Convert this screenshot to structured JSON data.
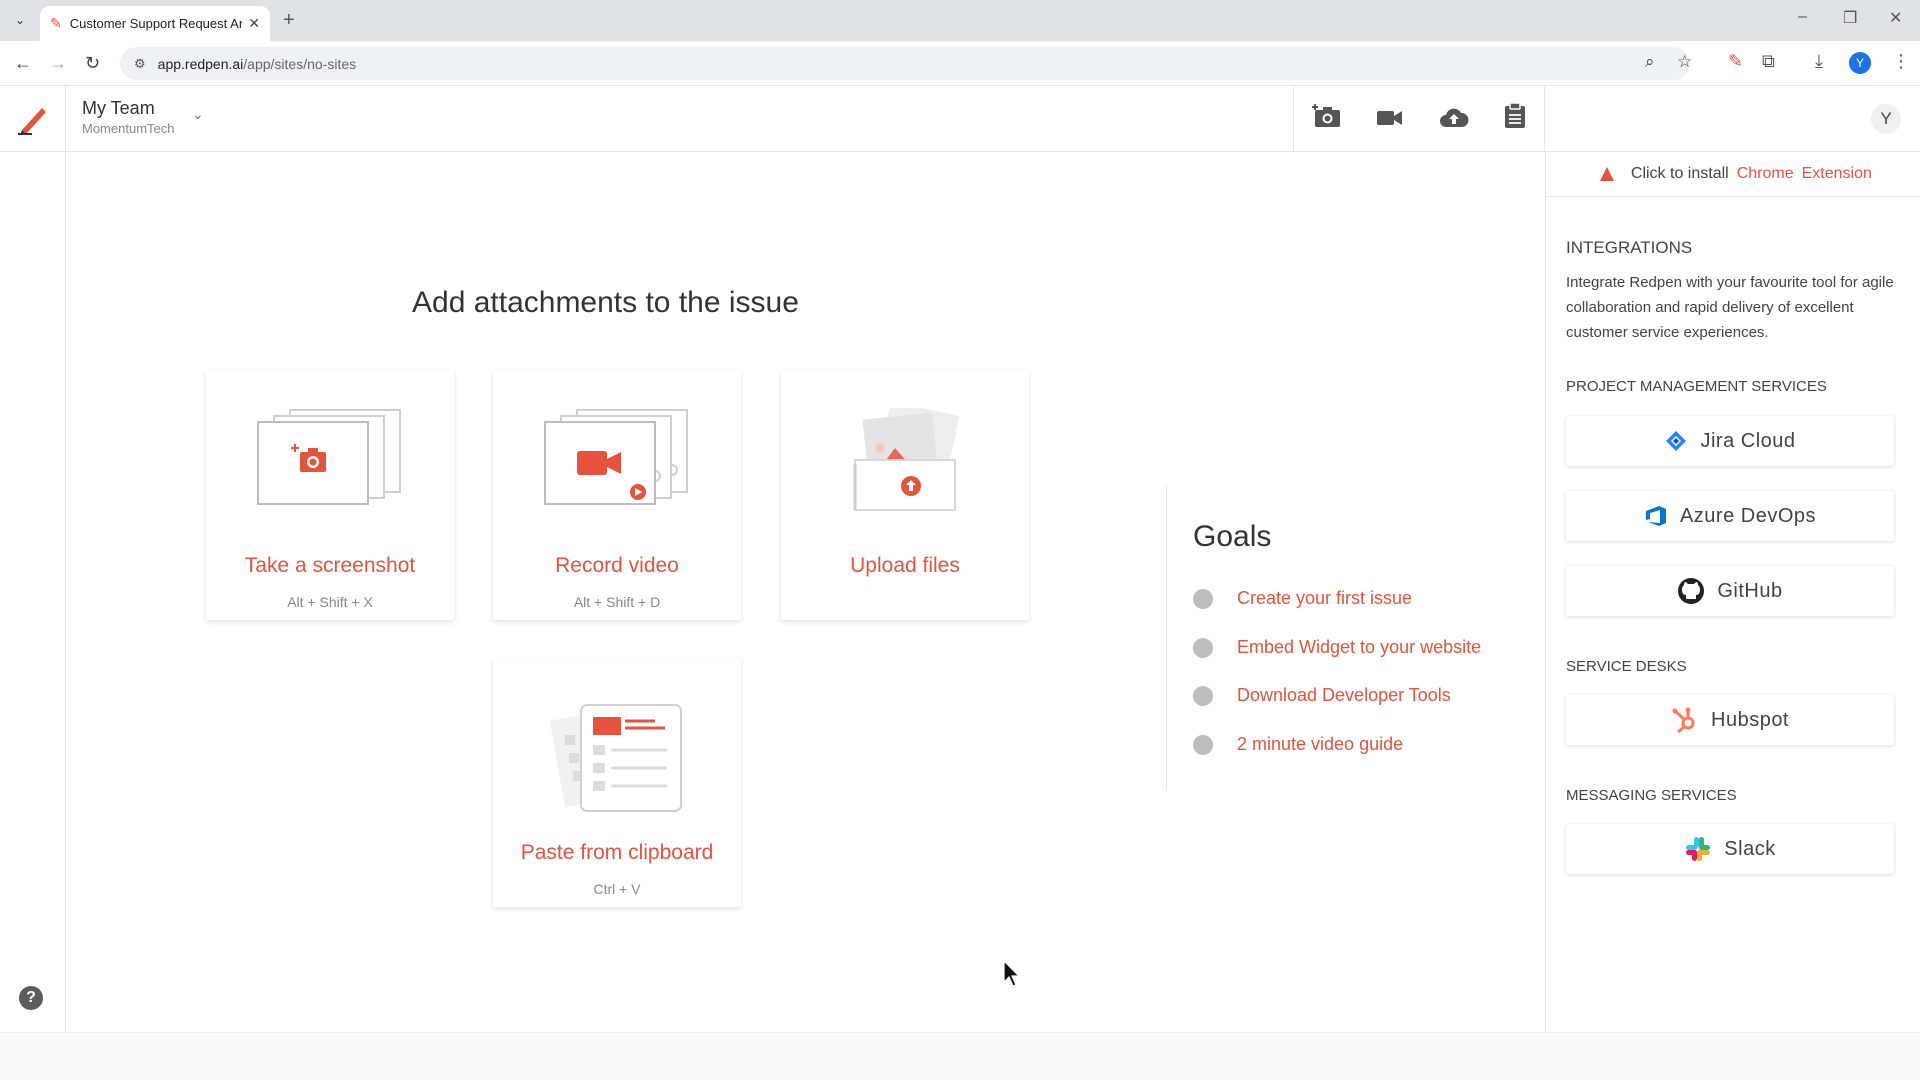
{
  "browser": {
    "tab_title": "Customer Support Request And",
    "url_host": "app.redpen.ai",
    "url_path": "/app/sites/no-sites",
    "profile_initial": "Y"
  },
  "app": {
    "team_name": "My Team",
    "org_name": "MomentumTech",
    "avatar_initial": "Y",
    "accent_color": "#e5533d"
  },
  "main": {
    "heading": "Add attachments to the issue",
    "cards": [
      {
        "label": "Take a screenshot",
        "shortcut": "Alt + Shift + X"
      },
      {
        "label": "Record video",
        "shortcut": "Alt + Shift + D"
      },
      {
        "label": "Upload files",
        "shortcut": ""
      },
      {
        "label": "Paste from clipboard",
        "shortcut": "Ctrl + V"
      }
    ]
  },
  "goals": {
    "title": "Goals",
    "items": [
      "Create your first issue",
      "Embed Widget to your website",
      "Download Developer Tools",
      "2 minute video guide"
    ]
  },
  "right_panel": {
    "install_text": "Click to install",
    "install_link1": "Chrome",
    "install_link2": "Extension",
    "integrations_title": "INTEGRATIONS",
    "integrations_desc": "Integrate Redpen with your favourite tool for agile collaboration and rapid delivery of excellent customer service experiences.",
    "pm_title": "PROJECT MANAGEMENT SERVICES",
    "pm_items": [
      "Jira Cloud",
      "Azure DevOps",
      "GitHub"
    ],
    "sd_title": "SERVICE DESKS",
    "sd_items": [
      "Hubspot"
    ],
    "msg_title": "MESSAGING SERVICES",
    "msg_items": [
      "Slack"
    ]
  }
}
